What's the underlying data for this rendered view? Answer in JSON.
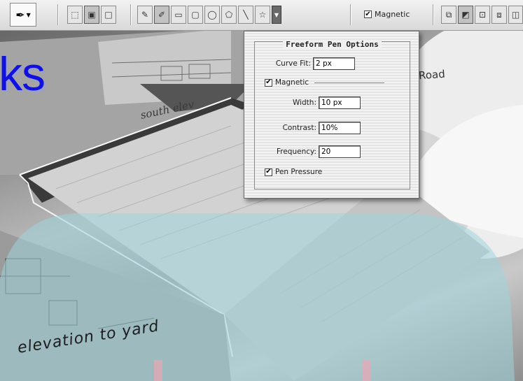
{
  "canvas": {
    "title_fragment": "ks",
    "road_text": "Road",
    "south_text": "south elev",
    "elevation_text": "elevation to yard"
  },
  "options_bar": {
    "magnetic_label": "Magnetic",
    "magnetic_checked": true
  },
  "panel": {
    "title": "Freeform Pen Options",
    "curve_fit_label": "Curve Fit:",
    "curve_fit_value": "2 px",
    "magnetic_label": "Magnetic",
    "width_label": "Width:",
    "width_value": "10 px",
    "contrast_label": "Contrast:",
    "contrast_value": "10%",
    "frequency_label": "Frequency:",
    "frequency_value": "20",
    "pen_pressure_label": "Pen Pressure"
  },
  "colors": {
    "title_blue": "#1010e0",
    "overlay_cyan": "#9fd3dc"
  }
}
